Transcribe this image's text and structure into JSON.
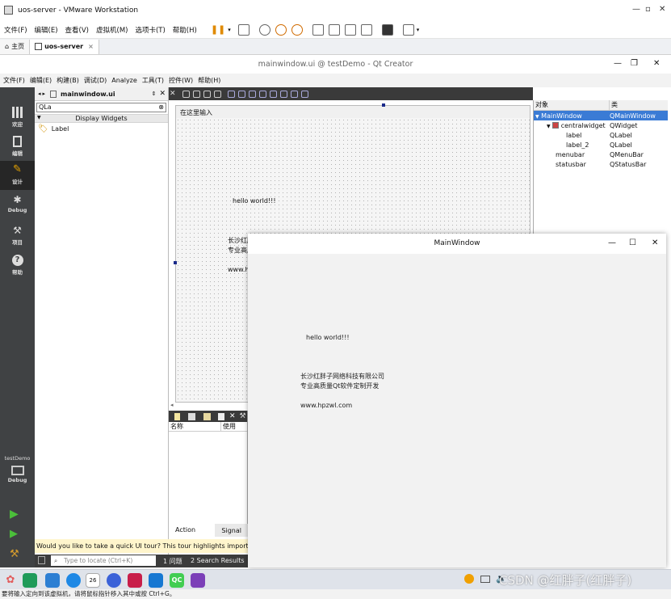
{
  "vmware": {
    "title": "uos-server - VMware Workstation",
    "menu": [
      "文件(F)",
      "编辑(E)",
      "查看(V)",
      "虚拟机(M)",
      "选项卡(T)",
      "帮助(H)"
    ],
    "tabs": [
      {
        "label": "主页"
      },
      {
        "label": "uos-server",
        "close": "×"
      }
    ],
    "window_controls": [
      "—",
      "▫",
      "✕"
    ]
  },
  "qt": {
    "title": "mainwindow.ui @ testDemo - Qt Creator",
    "window_controls": [
      "—",
      "❐",
      "✕"
    ],
    "menu": [
      "文件(F)",
      "编辑(E)",
      "构建(B)",
      "调试(D)",
      "Analyze",
      "工具(T)",
      "控件(W)",
      "帮助(H)"
    ],
    "modes": [
      {
        "label": "欢迎"
      },
      {
        "label": "编辑"
      },
      {
        "label": "设计"
      },
      {
        "label": "Debug"
      },
      {
        "label": "项目"
      },
      {
        "label": "帮助"
      }
    ],
    "target": {
      "project": "testDemo",
      "config": "Debug"
    },
    "file_tab": "mainwindow.ui",
    "widget_box": {
      "filter": "QLa",
      "group": "Display Widgets",
      "items": [
        "Label"
      ]
    },
    "form": {
      "menu_placeholder": "在这里输入",
      "label_hello": "hello world!!!",
      "label_2_lines": [
        "长沙红胖",
        "专业高质",
        "",
        "www.h"
      ]
    },
    "object_inspector": {
      "headers": [
        "对象",
        "类"
      ],
      "rows": [
        {
          "name": "MainWindow",
          "cls": "QMainWindow",
          "indent": 0,
          "selected": true
        },
        {
          "name": "centralwidget",
          "cls": "QWidget",
          "indent": 1
        },
        {
          "name": "label",
          "cls": "QLabel",
          "indent": 2
        },
        {
          "name": "label_2",
          "cls": "QLabel",
          "indent": 2
        },
        {
          "name": "menubar",
          "cls": "QMenuBar",
          "indent": 1
        },
        {
          "name": "statusbar",
          "cls": "QStatusBar",
          "indent": 1
        }
      ]
    },
    "action_editor": {
      "headers": [
        "名称",
        "使用"
      ],
      "tabs": [
        "Action Editor",
        "Signal"
      ]
    },
    "tour_text": "Would you like to take a quick UI tour? This tour highlights important use",
    "locator_placeholder": "Type to locate (Ctrl+K)",
    "output_tabs": [
      "1 问题",
      "2 Search Results"
    ]
  },
  "app_window": {
    "title": "MainWindow",
    "window_controls": [
      "—",
      "☐",
      "✕"
    ],
    "label_hello": "hello world!!!",
    "label_2": "长沙红胖子网络科技有限公司\n专业高质量Qt软件定制开发\n\nwww.hpzwl.com"
  },
  "taskbar": {
    "apps": [
      {
        "name": "launcher",
        "color": "#e25b5b"
      },
      {
        "name": "terminal",
        "color": "#1f9b5a"
      },
      {
        "name": "file-manager",
        "color": "#2d7fd3"
      },
      {
        "name": "browser",
        "color": "#1e88e5"
      },
      {
        "name": "calendar",
        "color": "#ffffff",
        "text": "26"
      },
      {
        "name": "settings",
        "color": "#3b62d8"
      },
      {
        "name": "red-app",
        "color": "#c81e4a"
      },
      {
        "name": "blue-app",
        "color": "#1677d2"
      },
      {
        "name": "qt-creator",
        "color": "#41cd52",
        "text": "QC"
      },
      {
        "name": "purple-app",
        "color": "#7b3fb8"
      }
    ]
  },
  "status_line": "要将输入定向到该虚拟机，请将鼠标指针移入其中或按 Ctrl+G。",
  "watermark": "CSDN @红胖子(红胖子)"
}
